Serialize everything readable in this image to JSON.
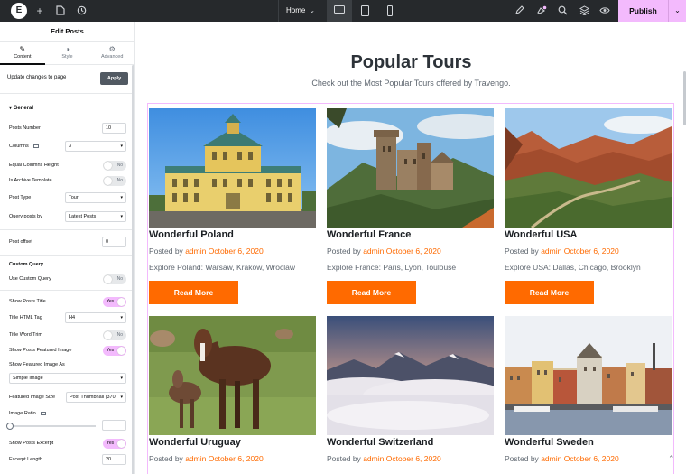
{
  "topbar": {
    "logo": "E",
    "page_name": "Home",
    "publish_label": "Publish"
  },
  "panel": {
    "title": "Edit Posts",
    "tabs": [
      {
        "label": "Content",
        "icon": "pencil-icon"
      },
      {
        "label": "Style",
        "icon": "half-circle-icon"
      },
      {
        "label": "Advanced",
        "icon": "gear-icon"
      }
    ],
    "update_label": "Update changes to page",
    "apply_label": "Apply",
    "general_heading": "General",
    "posts_number_label": "Posts Number",
    "posts_number_value": "10",
    "columns_label": "Columns",
    "columns_value": "3",
    "equal_height_label": "Equal Columns Height",
    "equal_height_toggle": "No",
    "archive_label": "Is Archive Template",
    "archive_toggle": "No",
    "post_type_label": "Post Type",
    "post_type_value": "Tour",
    "query_by_label": "Query posts by",
    "query_by_value": "Latest Posts",
    "offset_label": "Post offset",
    "offset_value": "0",
    "custom_query_heading": "Custom Query",
    "use_custom_label": "Use Custom Query",
    "use_custom_toggle": "No",
    "show_title_label": "Show Posts Title",
    "show_title_toggle": "Yes",
    "title_tag_label": "Title HTML Tag",
    "title_tag_value": "H4",
    "title_trim_label": "Title Word Trim",
    "title_trim_toggle": "No",
    "show_featured_label": "Show Posts Featured Image",
    "show_featured_toggle": "Yes",
    "featured_as_label": "Show Featured Image As",
    "featured_as_value": "Simple Image",
    "featured_size_label": "Featured Image Size",
    "featured_size_value": "Post Thumbnail (370",
    "ratio_label": "Image Ratio",
    "show_excerpt_label": "Show Posts Excerpt",
    "show_excerpt_toggle": "Yes",
    "excerpt_length_label": "Excerpt Length",
    "excerpt_length_value": "20"
  },
  "preview": {
    "heading": "Popular Tours",
    "subheading": "Check out the Most Popular Tours offered by Travengo.",
    "posted_by": "Posted by",
    "author": "admin",
    "read_more": "Read More",
    "cards": [
      {
        "title": "Wonderful Poland",
        "date": "October 6, 2020",
        "excerpt": "Explore Poland: Warsaw, Krakow, Wroclaw"
      },
      {
        "title": "Wonderful France",
        "date": "October 6, 2020",
        "excerpt": "Explore France: Paris, Lyon, Toulouse"
      },
      {
        "title": "Wonderful USA",
        "date": "October 6, 2020",
        "excerpt": "Explore USA: Dallas, Chicago, Brooklyn"
      },
      {
        "title": "Wonderful Uruguay",
        "date": "October 6, 2020",
        "excerpt": ""
      },
      {
        "title": "Wonderful Switzerland",
        "date": "October 6, 2020",
        "excerpt": ""
      },
      {
        "title": "Wonderful Sweden",
        "date": "October 6, 2020",
        "excerpt": ""
      }
    ]
  },
  "colors": {
    "accent": "#ff6a00",
    "publish": "#f3bafd",
    "topbar": "#26292c"
  }
}
